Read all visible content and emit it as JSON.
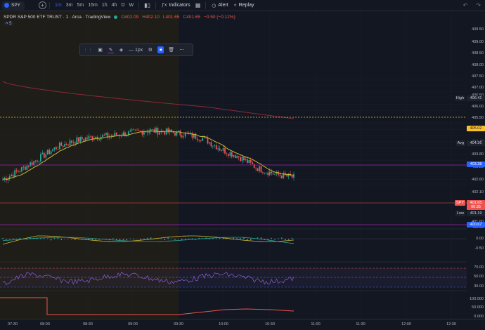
{
  "topbar": {
    "symbol": "SPY",
    "timeframes": [
      {
        "label": "1m",
        "active": true
      },
      {
        "label": "3m",
        "active": false
      },
      {
        "label": "5m",
        "active": false
      },
      {
        "label": "15m",
        "active": false
      },
      {
        "label": "1h",
        "active": false
      },
      {
        "label": "4h",
        "active": false
      },
      {
        "label": "D",
        "active": false
      },
      {
        "label": "W",
        "active": false
      }
    ],
    "indicators_label": "Indicators",
    "alert_label": "Alert",
    "replay_label": "Replay"
  },
  "legend": {
    "title": "SPDR S&P 500 ETF TRUST · 1 · Arca · TradingView",
    "ohlc": [
      {
        "label": "O",
        "value": "402.09"
      },
      {
        "label": "H",
        "value": "402.10"
      },
      {
        "label": "L",
        "value": "401.65"
      },
      {
        "label": "C",
        "value": "401.65"
      }
    ],
    "change": "−0.50 (−0.12%)",
    "indicator_count": "5"
  },
  "draw_toolbar": {
    "width_label": "1px"
  },
  "price_scale": {
    "labels": [
      "409.50",
      "409.00",
      "408.50",
      "408.00",
      "407.50",
      "407.00",
      "406.50",
      "406.00",
      "405.50",
      "405.00",
      "404.40",
      "403.80",
      "403.20",
      "402.60",
      "402.10",
      "401.60",
      "401.00"
    ],
    "high": {
      "label": "High",
      "value": "406.41"
    },
    "low": {
      "label": "Low",
      "value": "401.19"
    },
    "avg": {
      "label": "Avg",
      "value": "404.36"
    },
    "yellow_level": "405.02",
    "blue_level_upper": "403.38",
    "blue_level_lower": "400.67",
    "last": {
      "label": "SPY",
      "value": "401.65",
      "countdown": "00:35"
    },
    "osc_labels": [
      "0.00",
      "-0.50"
    ],
    "rsi_labels": [
      "70.00",
      "50.00",
      "30.00"
    ],
    "vol_labels": [
      "100.000",
      "50.000",
      "0.000"
    ]
  },
  "time_axis": [
    "07:30",
    "08:00",
    "08:30",
    "09:00",
    "09:30",
    "10:00",
    "10:30",
    "11:00",
    "11:30",
    "12:00",
    "12:30"
  ],
  "colors": {
    "up": "#26a69a",
    "down": "#ef5350",
    "premarket_bg": "#1f1d18",
    "ma_yellow": "#c9b934",
    "ma_red": "#8a2a36",
    "purple_line": "#9c27b0",
    "rsi": "#7e57c2"
  },
  "chart_data": {
    "type": "line",
    "series": [
      {
        "values": [
          401.5,
          402.3,
          403.2,
          404.1,
          404.6,
          404.9,
          405.0,
          405.2,
          405.4,
          405.3,
          405.1,
          404.8,
          403.9,
          403.3,
          402.4,
          401.9,
          401.65
        ]
      }
    ],
    "x": [
      "07:30",
      "07:45",
      "08:00",
      "08:15",
      "08:30",
      "08:45",
      "09:00",
      "09:15",
      "09:30",
      "09:45",
      "10:00",
      "10:10",
      "10:20",
      "10:25",
      "10:30",
      "10:35",
      "10:40"
    ]
  }
}
